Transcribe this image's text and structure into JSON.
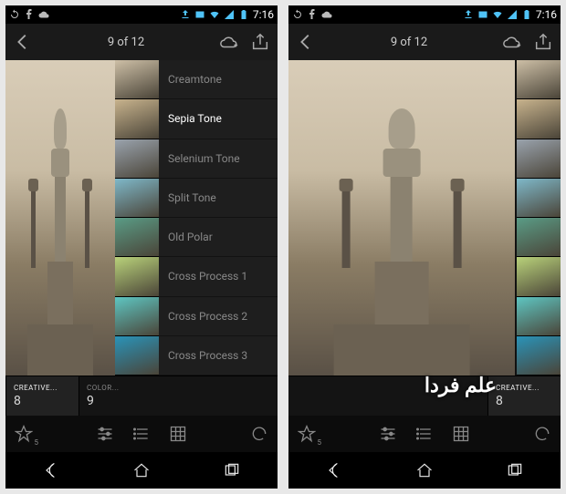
{
  "status": {
    "time": "7:16",
    "icons_left": [
      "sync-icon",
      "facebook-icon",
      "cloud-icon"
    ],
    "icons_right": [
      "upload-icon",
      "gallery-icon",
      "wifi-icon",
      "signal-icon",
      "battery-icon"
    ]
  },
  "appbar": {
    "counter": "9 of 12"
  },
  "presets": {
    "items": [
      {
        "label": "Creamtone",
        "tint": "#cdbfa6"
      },
      {
        "label": "Sepia Tone",
        "tint": "#c8b38d",
        "selected": true
      },
      {
        "label": "Selenium Tone",
        "tint": "#9aa3ad"
      },
      {
        "label": "Split Tone",
        "tint": "#7fb8c9"
      },
      {
        "label": "Old Polar",
        "tint": "#5a9c86"
      },
      {
        "label": "Cross Process 1",
        "tint": "#b9d27a"
      },
      {
        "label": "Cross Process 2",
        "tint": "#5ec6c2"
      },
      {
        "label": "Cross Process 3",
        "tint": "#2a93b8"
      }
    ]
  },
  "params": {
    "left_phone": [
      {
        "name": "CREATIVE...",
        "value": "8",
        "active": true
      },
      {
        "name": "COLOR...",
        "value": "9",
        "active": false
      }
    ],
    "right_phone": [
      {
        "name": "CREATIVE...",
        "value": "8",
        "active": true
      }
    ]
  },
  "toolbar": {
    "star_count": "5"
  },
  "watermark": "علم فردا"
}
